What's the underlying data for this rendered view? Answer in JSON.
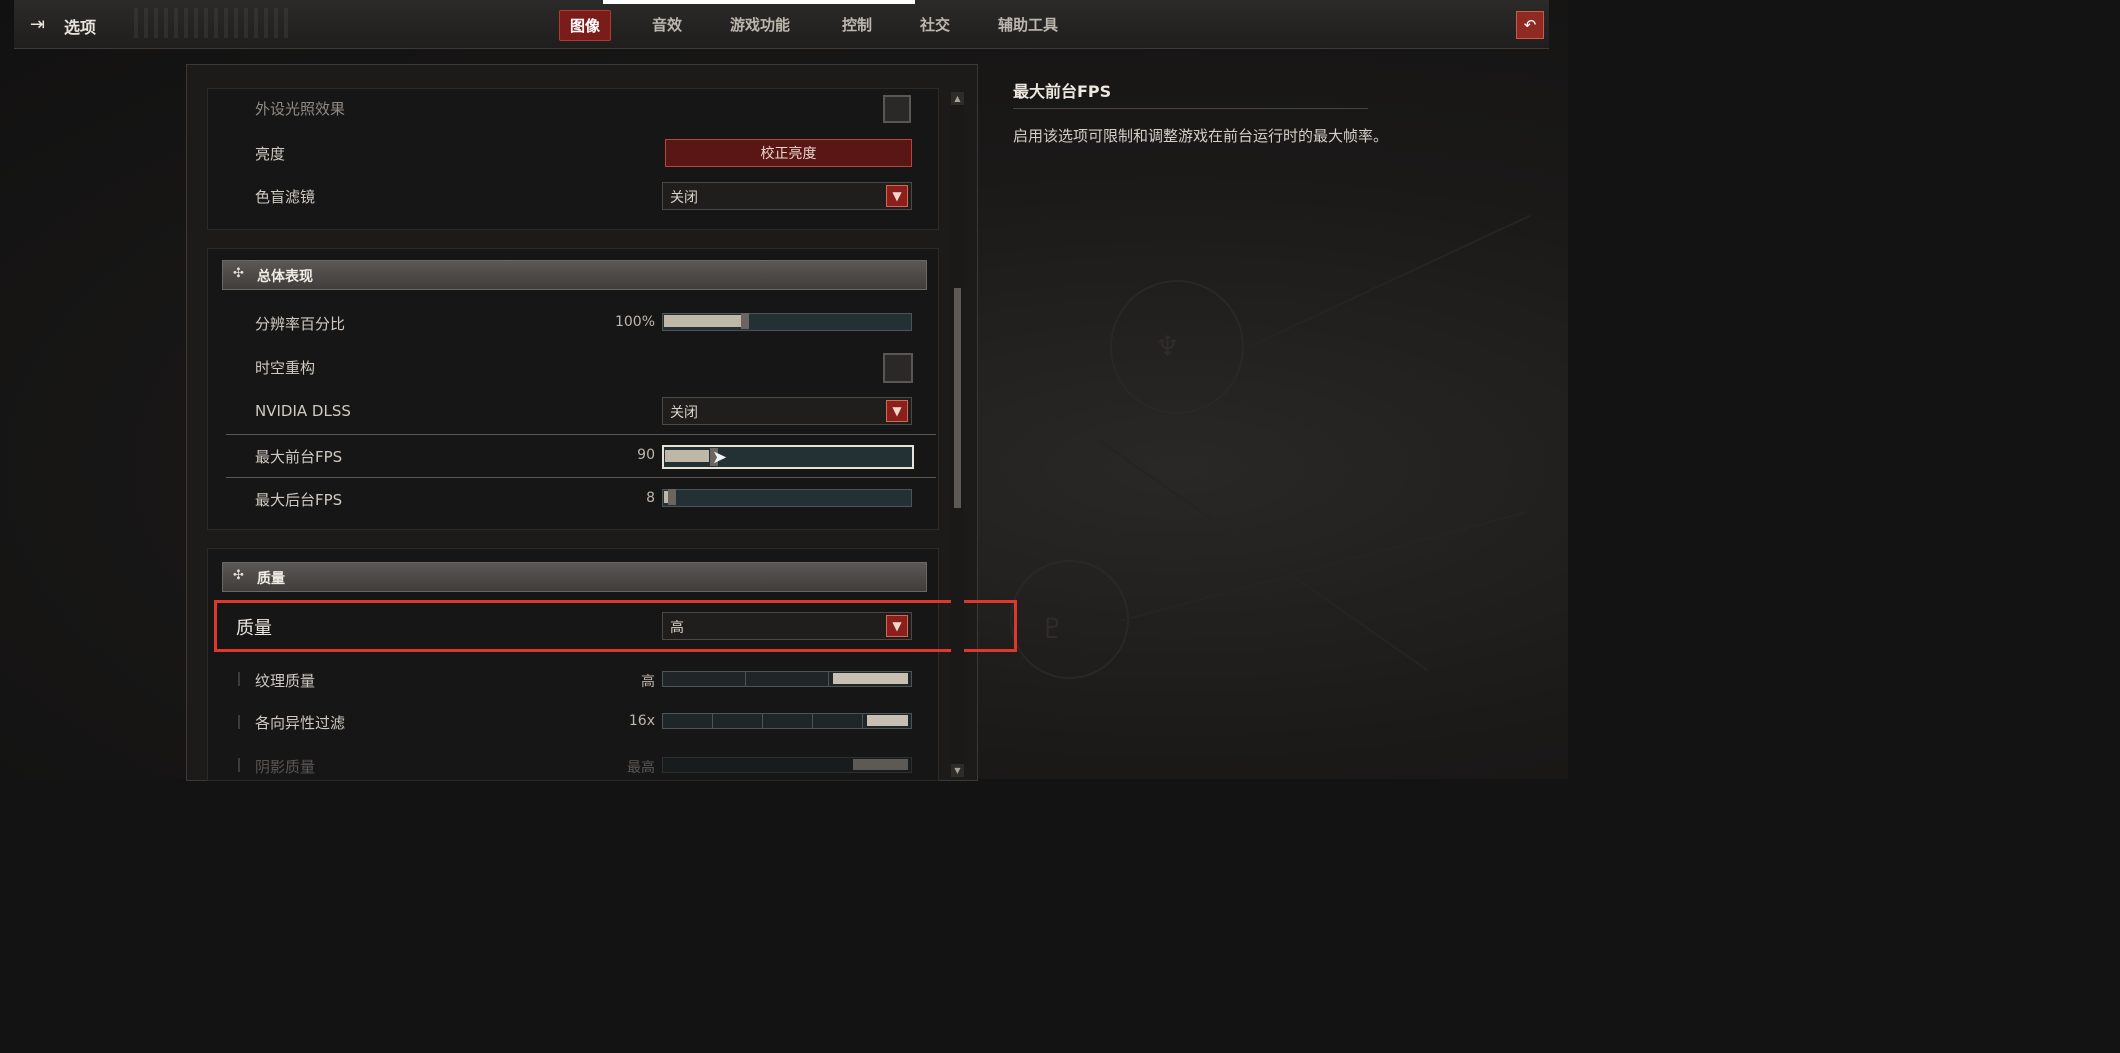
{
  "window": {
    "title": "选项",
    "back_icon": "back-arrow-icon",
    "close_icon": "return-icon"
  },
  "tabs": [
    {
      "label": "图像",
      "active": true
    },
    {
      "label": "音效",
      "active": false
    },
    {
      "label": "游戏功能",
      "active": false
    },
    {
      "label": "控制",
      "active": false
    },
    {
      "label": "社交",
      "active": false
    },
    {
      "label": "辅助工具",
      "active": false
    }
  ],
  "display": {
    "peripheral_lighting": {
      "label": "外设光照效果",
      "checked": false
    },
    "brightness": {
      "label": "亮度",
      "button": "校正亮度"
    },
    "colorblind": {
      "label": "色盲滤镜",
      "value": "关闭"
    }
  },
  "performance": {
    "header": "总体表现",
    "resolution": {
      "label": "分辨率百分比",
      "value": "100%",
      "fraction": 0.33
    },
    "temporal": {
      "label": "时空重构",
      "checked": false
    },
    "dlss": {
      "label": "NVIDIA DLSS",
      "value": "关闭"
    },
    "max_fg_fps": {
      "label": "最大前台FPS",
      "value": "90",
      "fraction": 0.22
    },
    "max_bg_fps": {
      "label": "最大后台FPS",
      "value": "8",
      "fraction": 0.02
    }
  },
  "quality": {
    "header": "质量",
    "preset": {
      "label": "质量",
      "value": "高"
    },
    "texture": {
      "label": "纹理质量",
      "value": "高"
    },
    "anisotropic": {
      "label": "各向异性过滤",
      "value": "16x"
    },
    "shadow": {
      "label": "阴影质量",
      "value": "最高"
    }
  },
  "info": {
    "title": "最大前台FPS",
    "description": "启用该选项可限制和调整游戏在前台运行时的最大帧率。"
  },
  "colors": {
    "accent_red": "#8a1f1c",
    "highlight": "#e0372c"
  }
}
